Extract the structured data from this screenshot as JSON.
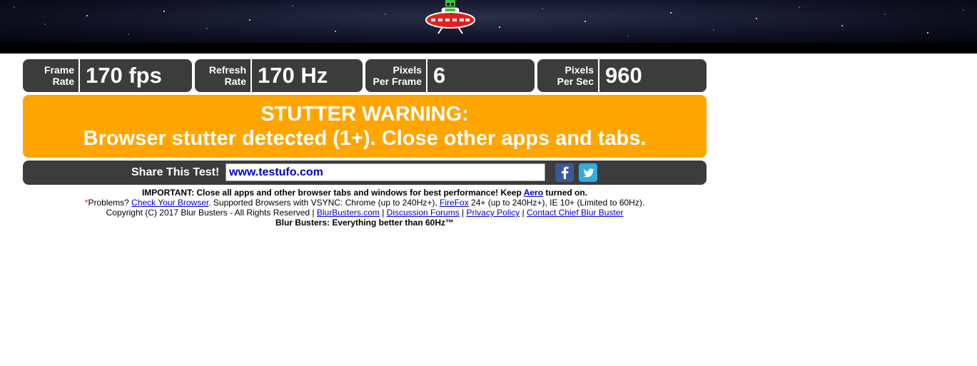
{
  "stats": [
    {
      "label_line1": "Frame",
      "label_line2": "Rate",
      "value": "170 fps"
    },
    {
      "label_line1": "Refresh",
      "label_line2": "Rate",
      "value": "170 Hz"
    },
    {
      "label_line1": "Pixels",
      "label_line2": "Per Frame",
      "value": "6"
    },
    {
      "label_line1": "Pixels",
      "label_line2": "Per Sec",
      "value": "960"
    }
  ],
  "warning": {
    "title": "STUTTER WARNING:",
    "message": "Browser stutter detected (1+). Close other apps and tabs."
  },
  "share": {
    "label": "Share This Test!",
    "url": "www.testufo.com"
  },
  "footer": {
    "important_prefix": "IMPORTANT: Close all apps and other browser tabs and windows for best performance! Keep ",
    "aero_link": "Aero",
    "important_suffix": " turned on.",
    "problems_star": "*",
    "problems_prefix": "Problems? ",
    "check_browser_link": "Check Your Browser",
    "supported_text": ". Supported Browsers with VSYNC: Chrome (up to 240Hz+), ",
    "firefox_link": "FireFox",
    "supported_rest": " 24+ (up to 240Hz+), IE 10+ (Limited to 60Hz).",
    "copyright": "Copyright (C) 2017 Blur Busters - All Rights Reserved | ",
    "blurbusters_link": "BlurBusters.com",
    "sep1": " | ",
    "forums_link": "Discussion Forums",
    "sep2": " | ",
    "privacy_link": "Privacy Policy",
    "sep3": " | ",
    "contact_link": "Contact Chief Blur Buster",
    "tagline": "Blur Busters: Everything better than 60Hz™"
  },
  "colors": {
    "stat_bg": "#3c3c3c",
    "warning_bg": "#ffa500",
    "link": "#0000cc"
  },
  "icons": [
    "ufo-logo-icon",
    "facebook-icon",
    "twitter-icon"
  ]
}
